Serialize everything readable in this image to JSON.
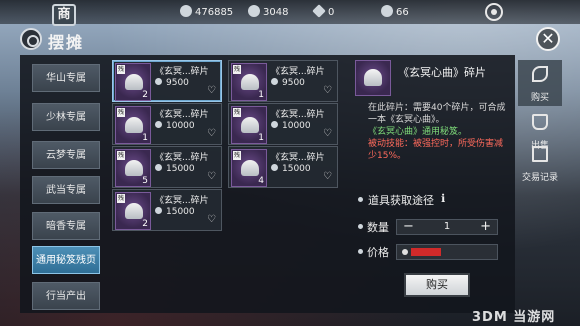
{
  "header": {
    "shop_emblem": "商",
    "title": "摆摊",
    "resources": [
      {
        "icon": "silver-coin-icon",
        "value": "476885"
      },
      {
        "icon": "silver-ingot-icon",
        "value": "3048"
      },
      {
        "icon": "gem-icon",
        "value": "0"
      },
      {
        "icon": "jade-icon",
        "value": "66"
      }
    ]
  },
  "categories": [
    {
      "label": "华山专属",
      "active": false
    },
    {
      "label": "少林专属",
      "active": false
    },
    {
      "label": "云梦专属",
      "active": false
    },
    {
      "label": "武当专属",
      "active": false
    },
    {
      "label": "暗香专属",
      "active": false
    },
    {
      "label": "通用秘笈残页",
      "active": true
    },
    {
      "label": "行当产出",
      "active": false
    }
  ],
  "items": [
    {
      "name": "《玄冥...碎片",
      "price": "9500",
      "qty": "2",
      "tag": "残",
      "selected": true
    },
    {
      "name": "《玄冥...碎片",
      "price": "9500",
      "qty": "1",
      "tag": "残",
      "selected": false
    },
    {
      "name": "《玄冥...碎片",
      "price": "10000",
      "qty": "1",
      "tag": "残",
      "selected": false
    },
    {
      "name": "《玄冥...碎片",
      "price": "10000",
      "qty": "1",
      "tag": "残",
      "selected": false
    },
    {
      "name": "《玄冥...碎片",
      "price": "15000",
      "qty": "5",
      "tag": "残",
      "selected": false
    },
    {
      "name": "《玄冥...碎片",
      "price": "15000",
      "qty": "4",
      "tag": "残",
      "selected": false
    },
    {
      "name": "《玄冥...碎片",
      "price": "15000",
      "qty": "2",
      "tag": "残",
      "selected": false
    }
  ],
  "detail": {
    "name": "《玄冥心曲》碎片",
    "desc_lines": [
      {
        "text": "在此碎片：需要40个碎片，可合成",
        "color": "white"
      },
      {
        "text": "一本《玄冥心曲》。",
        "color": "white"
      },
      {
        "text": "《玄冥心曲》通用秘笈。",
        "color": "green"
      },
      {
        "text": "被动技能：被强控时，所受伤害减",
        "color": "red"
      },
      {
        "text": "少15%。",
        "color": "red"
      }
    ],
    "source_label": "道具获取途径",
    "quantity_label": "数量",
    "quantity_value": "1",
    "price_label": "价格",
    "buy_label": "购买"
  },
  "side_tabs": [
    {
      "label": "购买",
      "icon": "leaf-icon",
      "active": true
    },
    {
      "label": "出售",
      "icon": "bag-icon",
      "active": false
    },
    {
      "label": "交易记录",
      "icon": "ledger-icon",
      "active": false
    }
  ],
  "watermark": "3DM 当游网"
}
